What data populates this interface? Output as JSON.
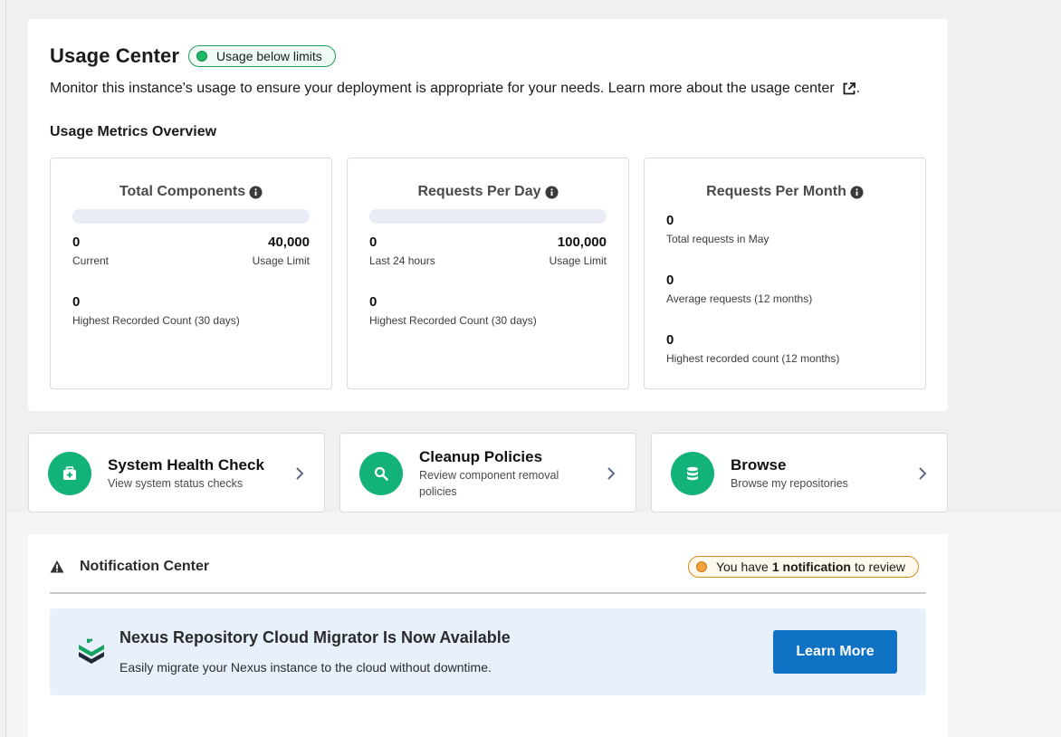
{
  "usage_center": {
    "title": "Usage Center",
    "status_badge": "Usage below limits",
    "description": "Monitor this instance's usage to ensure your deployment is appropriate for your needs. Learn more about the usage center",
    "metrics_title": "Usage Metrics Overview",
    "cards": [
      {
        "title": "Total Components",
        "progress": 0,
        "current_value": "0",
        "current_label": "Current",
        "limit_value": "40,000",
        "limit_label": "Usage Limit",
        "highest_value": "0",
        "highest_label": "Highest Recorded Count (30 days)"
      },
      {
        "title": "Requests Per Day",
        "progress": 0,
        "current_value": "0",
        "current_label": "Last 24 hours",
        "limit_value": "100,000",
        "limit_label": "Usage Limit",
        "highest_value": "0",
        "highest_label": "Highest Recorded Count (30 days)"
      },
      {
        "title": "Requests Per Month",
        "stats": [
          {
            "value": "0",
            "label": "Total requests in May"
          },
          {
            "value": "0",
            "label": "Average requests (12 months)"
          },
          {
            "value": "0",
            "label": "Highest recorded count (12 months)"
          }
        ]
      }
    ]
  },
  "actions": [
    {
      "title": "System Health Check",
      "subtitle": "View system status checks",
      "icon": "medical-kit-icon"
    },
    {
      "title": "Cleanup Policies",
      "subtitle": "Review component removal policies",
      "icon": "search-icon"
    },
    {
      "title": "Browse",
      "subtitle": "Browse my repositories",
      "icon": "database-icon"
    }
  ],
  "notifications": {
    "title": "Notification Center",
    "badge_prefix": "You have",
    "badge_bold": "1 notification",
    "badge_suffix": "to review",
    "announcement": {
      "title": "Nexus Repository Cloud Migrator Is Now Available",
      "subtitle": "Easily migrate your Nexus instance to the cloud without downtime.",
      "button_label": "Learn More"
    }
  },
  "colors": {
    "accent_green": "#12b279",
    "primary_blue": "#0f72c4",
    "warning_orange": "#f5a33a"
  }
}
